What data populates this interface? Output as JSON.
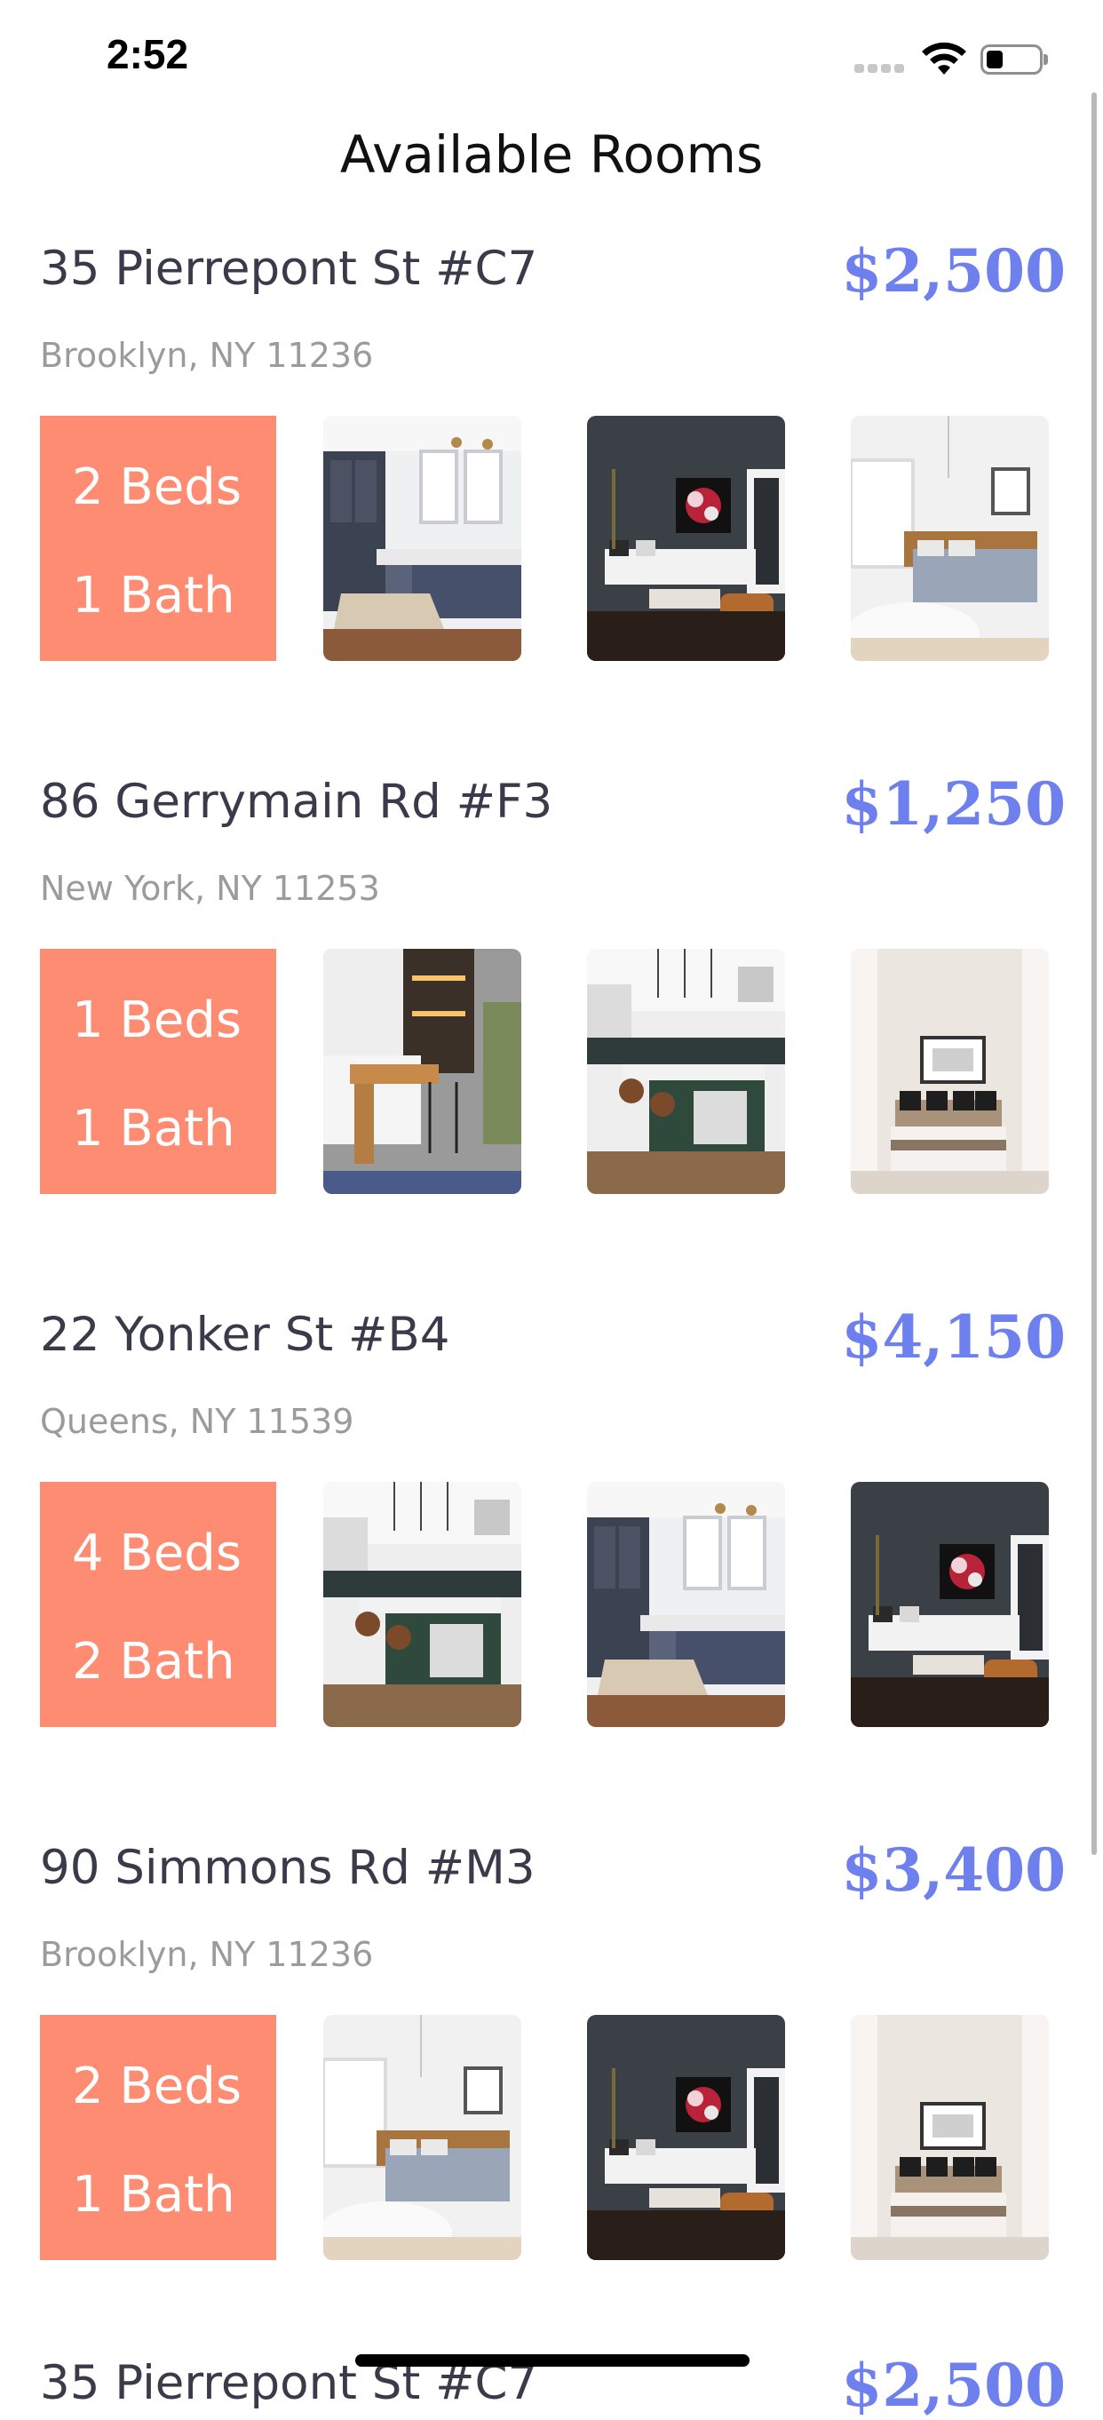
{
  "status_bar": {
    "time": "2:52"
  },
  "header": {
    "title": "Available Rooms"
  },
  "colors": {
    "accent_price": "#6e7fee",
    "info_box": "#fd8c73",
    "address_text": "#3a3a4a",
    "location_text": "#9b9b9b"
  },
  "listings": [
    {
      "address": "35 Pierrepont St #C7",
      "price": "$2,500",
      "location": "Brooklyn, NY 11236",
      "beds": "2 Beds",
      "baths": "1 Bath",
      "photos": [
        "kitchen-navy-photo",
        "living-room-dark-photo",
        "bedroom-white-photo"
      ]
    },
    {
      "address": "86 Gerrymain Rd #F3",
      "price": "$1,250",
      "location": "New York, NY 11253",
      "beds": "1 Beds",
      "baths": "1 Bath",
      "photos": [
        "kitchen-bar-photo",
        "kitchen-green-island-photo",
        "bedroom-framed-art-photo"
      ]
    },
    {
      "address": "22 Yonker St #B4",
      "price": "$4,150",
      "location": "Queens, NY 11539",
      "beds": "4 Beds",
      "baths": "2 Bath",
      "photos": [
        "kitchen-green-island-photo",
        "kitchen-navy-photo",
        "living-room-dark-photo"
      ]
    },
    {
      "address": "90 Simmons Rd #M3",
      "price": "$3,400",
      "location": "Brooklyn, NY 11236",
      "beds": "2 Beds",
      "baths": "1 Bath",
      "photos": [
        "bedroom-white-photo",
        "living-room-dark-photo",
        "bedroom-framed-art-photo"
      ]
    }
  ],
  "partial_listing": {
    "address": "35 Pierrepont St #C7",
    "price": "$2,500"
  }
}
